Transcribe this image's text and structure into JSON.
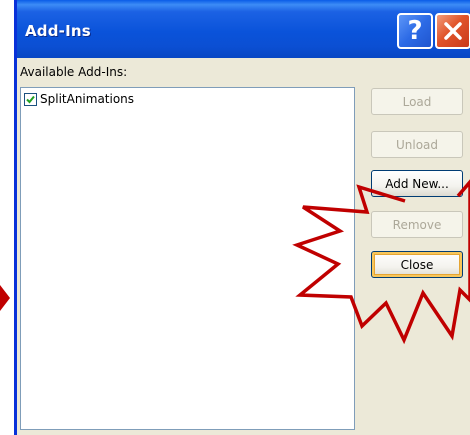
{
  "window": {
    "title": "Add-Ins"
  },
  "title_buttons": {
    "help_glyph": "?",
    "close_glyph": "close-icon"
  },
  "available_label": "Available Add-Ins:",
  "addins": [
    {
      "label": "SplitAnimations",
      "checked": true
    }
  ],
  "buttons": {
    "load": {
      "label": "Load",
      "enabled": false
    },
    "unload": {
      "label": "Unload",
      "enabled": false
    },
    "add_new": {
      "label": "Add New...",
      "enabled": true
    },
    "remove": {
      "label": "Remove",
      "enabled": false
    },
    "close": {
      "label": "Close",
      "enabled": true
    }
  },
  "colors": {
    "title_bar_blue": "#0b4fd3",
    "dialog_face": "#ece9d8",
    "highlight_red": "#c00000",
    "close_red": "#e0542a"
  }
}
